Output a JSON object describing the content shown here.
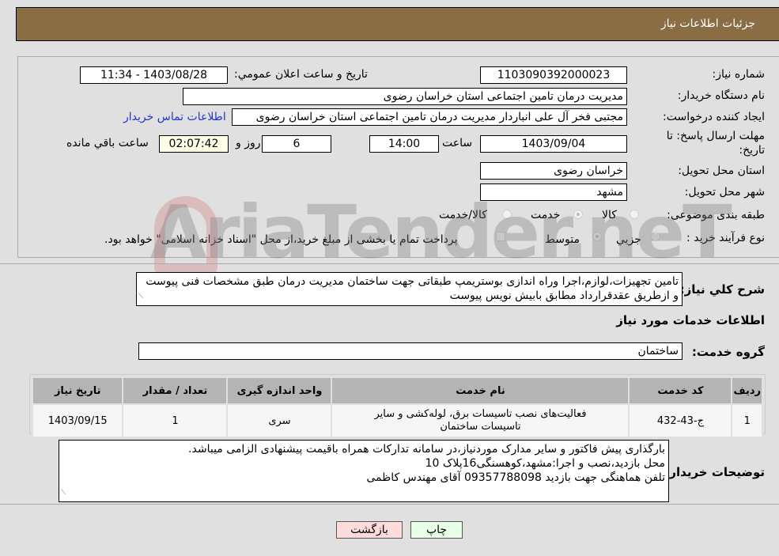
{
  "header": {
    "title": "جزئیات اطلاعات نیاز"
  },
  "form": {
    "need_number_label": "شماره نیاز:",
    "need_number": "1103090392000023",
    "announce_label": "تاريخ و ساعت اعلان عمومي:",
    "announce_value": "1403/08/28 - 11:34",
    "buyer_org_label": "نام دستگاه خریدار:",
    "buyer_org": "مدیریت درمان تامین اجتماعی استان خراسان رضوی",
    "creator_label": "ایجاد کننده درخواست:",
    "creator": "مجتبی فخر آل علی انباردار مدیریت درمان تامین اجتماعی استان خراسان رضوی",
    "contact_link": "اطلاعات تماس خریدار",
    "deadline_label_1": "مهلت ارسال پاسخ: تا",
    "deadline_label_2": "تاریخ:",
    "deadline_date": "1403/09/04",
    "time_label": "ساعت",
    "deadline_time": "14:00",
    "days_value": "6",
    "days_label": "روز و",
    "remaining_time": "02:07:42",
    "remaining_label": "ساعت باقي مانده",
    "province_label": "استان محل تحویل:",
    "province": "خراسان رضوی",
    "city_label": "شهر محل تحویل:",
    "city": "مشهد",
    "category_label": "طبقه بندی موضوعی:",
    "category_options": [
      "کالا",
      "خدمت",
      "کالا/خدمت"
    ],
    "category_selected": "خدمت",
    "process_label": "نوع فرآیند خرید :",
    "process_options": [
      "جزيي",
      "متوسط"
    ],
    "process_selected": "متوسط",
    "treasury_note": "پرداخت تمام یا بخشی از مبلغ خرید،از محل \"اسناد خزانه اسلامی\" خواهد بود.",
    "treasury_checked": false
  },
  "description": {
    "label": "شرح كلي نياز:",
    "text": "تامین تجهیزات،لوازم،اجرا وراه اندازی بوستریمپ طبقاتی جهت ساختمان مدیریت درمان طبق مشخصات فنی پیوست و ازطریق عقدقرارداد مطابق بابیش نویس پیوست"
  },
  "services": {
    "section_title": "اطلاعات خدمات مورد نیاز",
    "group_label": "گروه خدمت:",
    "group_value": "ساختمان",
    "columns": [
      "ردیف",
      "کد خدمت",
      "نام خدمت",
      "واحد اندازه گیری",
      "تعداد / مقدار",
      "تاریخ نیاز"
    ],
    "rows": [
      {
        "index": "1",
        "code": "ج-43-432",
        "name": "فعالیت‌های نصب تاسیسات برق، لوله‌کشی و سایر تاسیسات ساختمان",
        "unit": "سری",
        "qty": "1",
        "date": "1403/09/15"
      }
    ]
  },
  "buyer_notes": {
    "label": "توضیحات خریدار:",
    "lines": [
      "بارگذاری پیش فاکتور و سایر مدارک موردنیاز،در سامانه تدارکات همراه باقیمت پیشنهادی الزامی میباشد.",
      "محل بازدید،نصب و اجرا:مشهد،کوهسنگی16پلاک 10",
      "تلفن هماهنگی جهت بازدید 09357788098 آقای مهندس کاظمی"
    ]
  },
  "buttons": {
    "print": "چاپ",
    "back": "بازگشت"
  },
  "watermark": {
    "text": "AriaTender.neT"
  },
  "colors": {
    "header_bg": "#8b6d44",
    "link": "#2233cc",
    "print_bg": "#e8ffe8",
    "back_bg": "#ffdcdc"
  }
}
